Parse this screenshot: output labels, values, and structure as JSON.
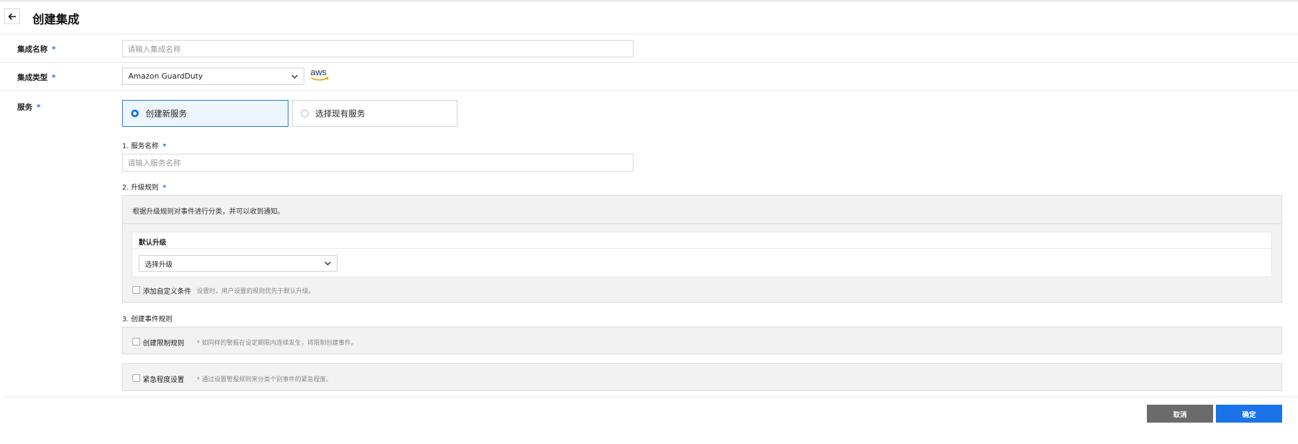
{
  "header": {
    "title": "创建集成"
  },
  "form": {
    "name": {
      "label": "集成名称",
      "required": "*",
      "placeholder": "请输入集成名称"
    },
    "type": {
      "label": "集成类型",
      "required": "*",
      "value": "Amazon GuardDuty",
      "provider_logo": "aws"
    },
    "service": {
      "label": "服务",
      "required": "*",
      "options": [
        {
          "label": "创建新服务",
          "selected": true
        },
        {
          "label": "选择现有服务",
          "selected": false
        }
      ]
    },
    "service_name": {
      "label": "1. 服务名称",
      "required": "*",
      "placeholder": "请输入服务名称"
    },
    "escalation": {
      "label": "2. 升级规则",
      "required": "*",
      "description": "根据升级规则对事件进行分类，并可以收到通知。",
      "default_title": "默认升级",
      "select_placeholder": "选择升级",
      "custom_condition_label": "添加自定义条件",
      "custom_condition_desc": "设置时，用户设置的规则优先于默认升级。"
    },
    "event_rules": {
      "label": "3. 创建事件规则",
      "limit_label": "创建限制规则",
      "limit_desc": "* 如同样的警报在设定期限内连续发生，将限制创建事件。",
      "urgency_label": "紧急程度设置",
      "urgency_desc": "* 通过设置警报规则来分类个别事件的紧急程度。"
    }
  },
  "footer": {
    "cancel_label": "取消",
    "confirm_label": "确定"
  },
  "colors": {
    "accent": "#1a73e8",
    "cancel_bg": "#6b6b6b",
    "confirm_bg": "#1a73e8",
    "aws_orange": "#f90"
  }
}
